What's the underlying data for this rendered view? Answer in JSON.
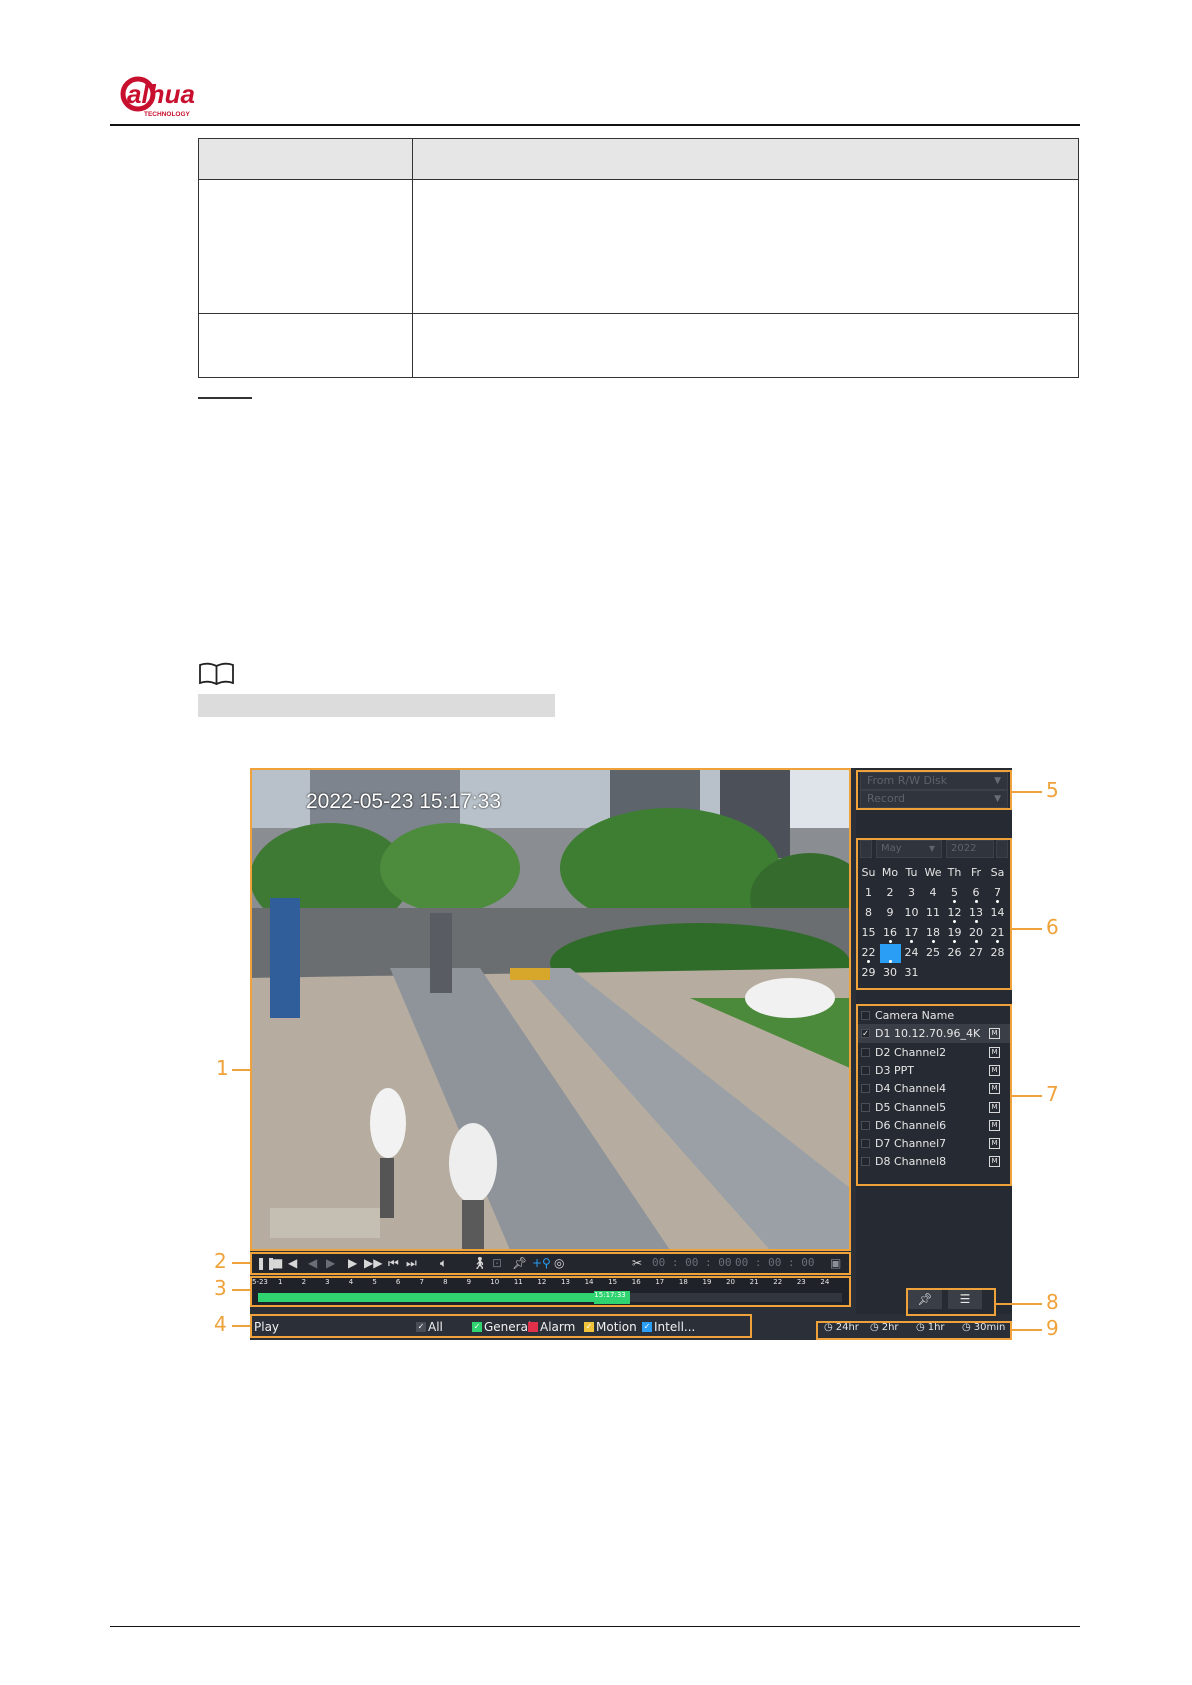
{
  "brand": {
    "name": "alhua",
    "tagline": "TECHNOLOGY",
    "color": "#c8102e"
  },
  "figure": {
    "video_timestamp": "2022-05-23 15:17:33",
    "controls": {
      "clip_start": "00 : 00 : 00",
      "clip_end": "00 : 00 : 00",
      "icons": [
        "pause-icon",
        "stop-icon",
        "play-backward-icon",
        "step-back-icon",
        "step-forward-icon",
        "slow-icon",
        "fast-icon",
        "previous-day-icon",
        "next-day-icon",
        "volume-icon",
        "smart-search-icon",
        "fisheye-icon",
        "tag-icon",
        "add-tag-icon",
        "snapshot-icon",
        "clip-icon",
        "save-icon"
      ]
    },
    "timeline": {
      "date_label": "5-23",
      "hours": [
        "1",
        "2",
        "3",
        "4",
        "5",
        "6",
        "7",
        "8",
        "9",
        "10",
        "11",
        "12",
        "13",
        "14",
        "15",
        "16",
        "17",
        "18",
        "19",
        "20",
        "21",
        "22",
        "23",
        "24"
      ],
      "recorded_until_hour": 15.3,
      "marker_label": "15:17:33"
    },
    "bottom": {
      "play_label": "Play",
      "filters": [
        {
          "label": "All",
          "color": "#4a4e57",
          "checked": true
        },
        {
          "label": "General",
          "color": "#2fd36f",
          "checked": true
        },
        {
          "label": "Alarm",
          "color": "#e0304a",
          "checked": false
        },
        {
          "label": "Motion",
          "color": "#f0c23a",
          "checked": true
        },
        {
          "label": "Intell...",
          "color": "#2a9df4",
          "checked": true
        }
      ],
      "time_scales": [
        "24hr",
        "2hr",
        "1hr",
        "30min"
      ]
    },
    "side": {
      "source": "From R/W Disk",
      "type": "Record",
      "month": "May",
      "year": "2022",
      "weekdays": [
        "Su",
        "Mo",
        "Tu",
        "We",
        "Th",
        "Fr",
        "Sa"
      ],
      "days_with_records": [
        5,
        6,
        7,
        12,
        13,
        16,
        17,
        18,
        19,
        20,
        21,
        22,
        23
      ],
      "selected_day": 23,
      "first_weekday_index": 0,
      "days_in_month": 31,
      "camera_header": "Camera Name",
      "cameras": [
        {
          "name": "D1 10.12.70.96_4K",
          "checked": true
        },
        {
          "name": "D2 Channel2",
          "checked": false
        },
        {
          "name": "D3 PPT",
          "checked": false
        },
        {
          "name": "D4 Channel4",
          "checked": false
        },
        {
          "name": "D5 Channel5",
          "checked": false
        },
        {
          "name": "D6 Channel6",
          "checked": false
        },
        {
          "name": "D7 Channel7",
          "checked": false
        },
        {
          "name": "D8 Channel8",
          "checked": false
        }
      ],
      "badge": "M"
    },
    "callouts": [
      "1",
      "2",
      "3",
      "4",
      "5",
      "6",
      "7",
      "8",
      "9"
    ]
  },
  "colors": {
    "callout": "#f0a23a",
    "accent": "#2a9df4",
    "record": "#2fd36f"
  }
}
